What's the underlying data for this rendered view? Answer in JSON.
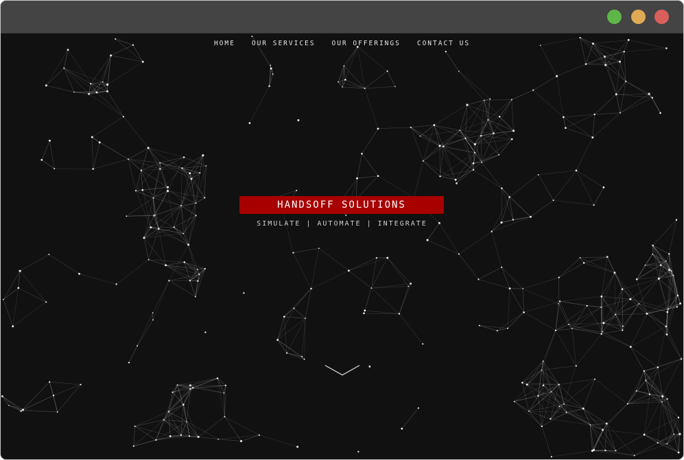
{
  "window": {
    "controls": {
      "minimize_color": "#5fb648",
      "maximize_color": "#dfaa55",
      "close_color": "#d9605a"
    }
  },
  "nav": {
    "items": [
      {
        "label": "HOME"
      },
      {
        "label": "OUR SERVICES"
      },
      {
        "label": "OUR OFFERINGS"
      },
      {
        "label": "CONTACT US"
      }
    ]
  },
  "hero": {
    "title": "HANDSOFF SOLUTIONS",
    "tagline": "SIMULATE | AUTOMATE | INTEGRATE",
    "accent_color": "#a80000",
    "background_color": "#111111",
    "scroll_icon": "chevron-down-icon"
  }
}
